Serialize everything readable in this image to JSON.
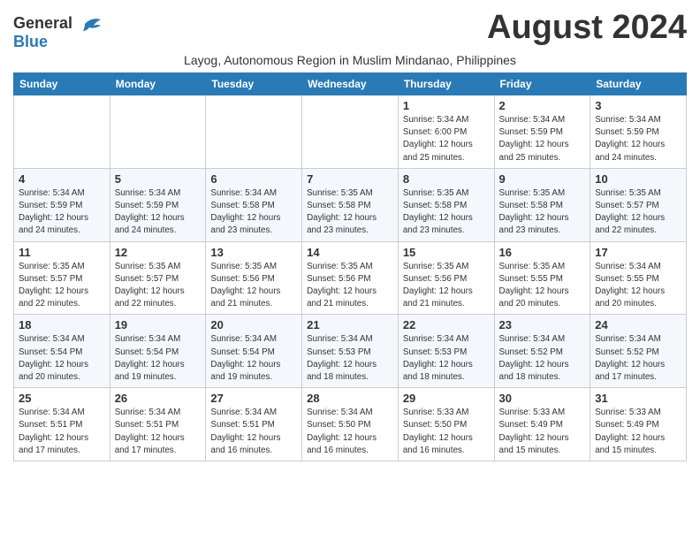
{
  "logo": {
    "general": "General",
    "blue": "Blue"
  },
  "title": "August 2024",
  "subtitle": "Layog, Autonomous Region in Muslim Mindanao, Philippines",
  "days_of_week": [
    "Sunday",
    "Monday",
    "Tuesday",
    "Wednesday",
    "Thursday",
    "Friday",
    "Saturday"
  ],
  "weeks": [
    [
      {
        "day": "",
        "info": ""
      },
      {
        "day": "",
        "info": ""
      },
      {
        "day": "",
        "info": ""
      },
      {
        "day": "",
        "info": ""
      },
      {
        "day": "1",
        "info": "Sunrise: 5:34 AM\nSunset: 6:00 PM\nDaylight: 12 hours\nand 25 minutes."
      },
      {
        "day": "2",
        "info": "Sunrise: 5:34 AM\nSunset: 5:59 PM\nDaylight: 12 hours\nand 25 minutes."
      },
      {
        "day": "3",
        "info": "Sunrise: 5:34 AM\nSunset: 5:59 PM\nDaylight: 12 hours\nand 24 minutes."
      }
    ],
    [
      {
        "day": "4",
        "info": "Sunrise: 5:34 AM\nSunset: 5:59 PM\nDaylight: 12 hours\nand 24 minutes."
      },
      {
        "day": "5",
        "info": "Sunrise: 5:34 AM\nSunset: 5:59 PM\nDaylight: 12 hours\nand 24 minutes."
      },
      {
        "day": "6",
        "info": "Sunrise: 5:34 AM\nSunset: 5:58 PM\nDaylight: 12 hours\nand 23 minutes."
      },
      {
        "day": "7",
        "info": "Sunrise: 5:35 AM\nSunset: 5:58 PM\nDaylight: 12 hours\nand 23 minutes."
      },
      {
        "day": "8",
        "info": "Sunrise: 5:35 AM\nSunset: 5:58 PM\nDaylight: 12 hours\nand 23 minutes."
      },
      {
        "day": "9",
        "info": "Sunrise: 5:35 AM\nSunset: 5:58 PM\nDaylight: 12 hours\nand 23 minutes."
      },
      {
        "day": "10",
        "info": "Sunrise: 5:35 AM\nSunset: 5:57 PM\nDaylight: 12 hours\nand 22 minutes."
      }
    ],
    [
      {
        "day": "11",
        "info": "Sunrise: 5:35 AM\nSunset: 5:57 PM\nDaylight: 12 hours\nand 22 minutes."
      },
      {
        "day": "12",
        "info": "Sunrise: 5:35 AM\nSunset: 5:57 PM\nDaylight: 12 hours\nand 22 minutes."
      },
      {
        "day": "13",
        "info": "Sunrise: 5:35 AM\nSunset: 5:56 PM\nDaylight: 12 hours\nand 21 minutes."
      },
      {
        "day": "14",
        "info": "Sunrise: 5:35 AM\nSunset: 5:56 PM\nDaylight: 12 hours\nand 21 minutes."
      },
      {
        "day": "15",
        "info": "Sunrise: 5:35 AM\nSunset: 5:56 PM\nDaylight: 12 hours\nand 21 minutes."
      },
      {
        "day": "16",
        "info": "Sunrise: 5:35 AM\nSunset: 5:55 PM\nDaylight: 12 hours\nand 20 minutes."
      },
      {
        "day": "17",
        "info": "Sunrise: 5:34 AM\nSunset: 5:55 PM\nDaylight: 12 hours\nand 20 minutes."
      }
    ],
    [
      {
        "day": "18",
        "info": "Sunrise: 5:34 AM\nSunset: 5:54 PM\nDaylight: 12 hours\nand 20 minutes."
      },
      {
        "day": "19",
        "info": "Sunrise: 5:34 AM\nSunset: 5:54 PM\nDaylight: 12 hours\nand 19 minutes."
      },
      {
        "day": "20",
        "info": "Sunrise: 5:34 AM\nSunset: 5:54 PM\nDaylight: 12 hours\nand 19 minutes."
      },
      {
        "day": "21",
        "info": "Sunrise: 5:34 AM\nSunset: 5:53 PM\nDaylight: 12 hours\nand 18 minutes."
      },
      {
        "day": "22",
        "info": "Sunrise: 5:34 AM\nSunset: 5:53 PM\nDaylight: 12 hours\nand 18 minutes."
      },
      {
        "day": "23",
        "info": "Sunrise: 5:34 AM\nSunset: 5:52 PM\nDaylight: 12 hours\nand 18 minutes."
      },
      {
        "day": "24",
        "info": "Sunrise: 5:34 AM\nSunset: 5:52 PM\nDaylight: 12 hours\nand 17 minutes."
      }
    ],
    [
      {
        "day": "25",
        "info": "Sunrise: 5:34 AM\nSunset: 5:51 PM\nDaylight: 12 hours\nand 17 minutes."
      },
      {
        "day": "26",
        "info": "Sunrise: 5:34 AM\nSunset: 5:51 PM\nDaylight: 12 hours\nand 17 minutes."
      },
      {
        "day": "27",
        "info": "Sunrise: 5:34 AM\nSunset: 5:51 PM\nDaylight: 12 hours\nand 16 minutes."
      },
      {
        "day": "28",
        "info": "Sunrise: 5:34 AM\nSunset: 5:50 PM\nDaylight: 12 hours\nand 16 minutes."
      },
      {
        "day": "29",
        "info": "Sunrise: 5:33 AM\nSunset: 5:50 PM\nDaylight: 12 hours\nand 16 minutes."
      },
      {
        "day": "30",
        "info": "Sunrise: 5:33 AM\nSunset: 5:49 PM\nDaylight: 12 hours\nand 15 minutes."
      },
      {
        "day": "31",
        "info": "Sunrise: 5:33 AM\nSunset: 5:49 PM\nDaylight: 12 hours\nand 15 minutes."
      }
    ]
  ]
}
